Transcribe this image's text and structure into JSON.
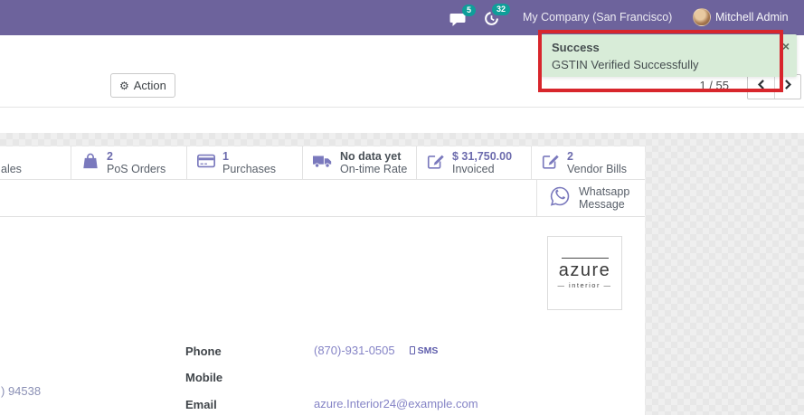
{
  "topbar": {
    "company": "My Company (San Francisco)",
    "user_name": "Mitchell Admin",
    "messages_badge": "5",
    "activities_badge": "32",
    "bg_color": "#6d639c",
    "badge_color": "#0f9e99"
  },
  "control_panel": {
    "action_label": "Action",
    "action_icon": "⚙",
    "pager_text": "1 / 55"
  },
  "toast": {
    "title": "Success",
    "message": "GSTIN Verified Successfully",
    "close": "×",
    "bg_color": "#d8ecd8",
    "highlight_border_color": "#d8262c"
  },
  "smart_buttons": {
    "icon_color": "#7a79bd",
    "value_color": "#6c6bad",
    "sales": {
      "label": "ales"
    },
    "pos": {
      "value": "2",
      "label": "PoS Orders"
    },
    "purchases": {
      "value": "1",
      "label": "Purchases"
    },
    "ontime": {
      "value": "No data yet",
      "label": "On-time Rate"
    },
    "invoiced": {
      "value": "$ 31,750.00",
      "label": "Invoiced"
    },
    "vendor_bills": {
      "value": "2",
      "label": "Vendor Bills"
    },
    "whatsapp": {
      "line1": "Whatsapp",
      "line2": "Message"
    }
  },
  "logo": {
    "brand": "azure",
    "sub": "— interior —"
  },
  "form": {
    "address_fragment": ") 94538",
    "fields": {
      "phone": {
        "label": "Phone",
        "value": "(870)-931-0505",
        "sms_label": "SMS"
      },
      "mobile": {
        "label": "Mobile",
        "value": ""
      },
      "email": {
        "label": "Email",
        "value": "azure.Interior24@example.com"
      }
    }
  }
}
